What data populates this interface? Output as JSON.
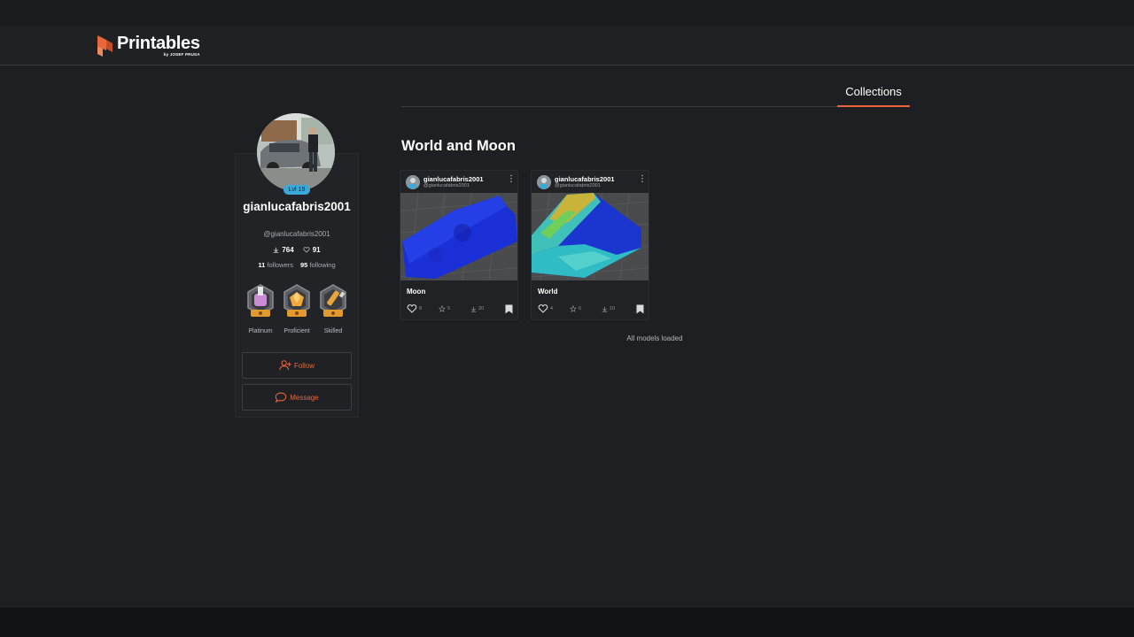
{
  "brand": {
    "name": "Printables",
    "sub": "by JOSEF PRUSA"
  },
  "colors": {
    "accent": "#e8673a",
    "level": "#38a9d9",
    "background": "#1d1f22"
  },
  "profile": {
    "level": "Lvl 19",
    "name": "gianlucafabris2001",
    "handle": "@gianlucafabris2001",
    "downloads": "764",
    "likes": "91",
    "followers_count": "11",
    "followers_label": "followers",
    "following_count": "95",
    "following_label": "following",
    "badges": [
      {
        "label": "Platinum",
        "icon": "platinum-badge-icon"
      },
      {
        "label": "Proficient",
        "icon": "proficient-badge-icon"
      },
      {
        "label": "Skilled",
        "icon": "skilled-badge-icon"
      }
    ],
    "follow_label": "Follow",
    "message_label": "Message"
  },
  "tabs": {
    "active": "Collections"
  },
  "collection": {
    "title": "World and Moon",
    "cards": [
      {
        "user": "gianlucafabris2001",
        "handle": "@gianlucafabris2001",
        "title": "Moon",
        "likes": "8",
        "stars": "5",
        "downloads": "20"
      },
      {
        "user": "gianlucafabris2001",
        "handle": "@gianlucafabris2001",
        "title": "World",
        "likes": "4",
        "stars": "6",
        "downloads": "10"
      }
    ],
    "status": "All models loaded"
  }
}
